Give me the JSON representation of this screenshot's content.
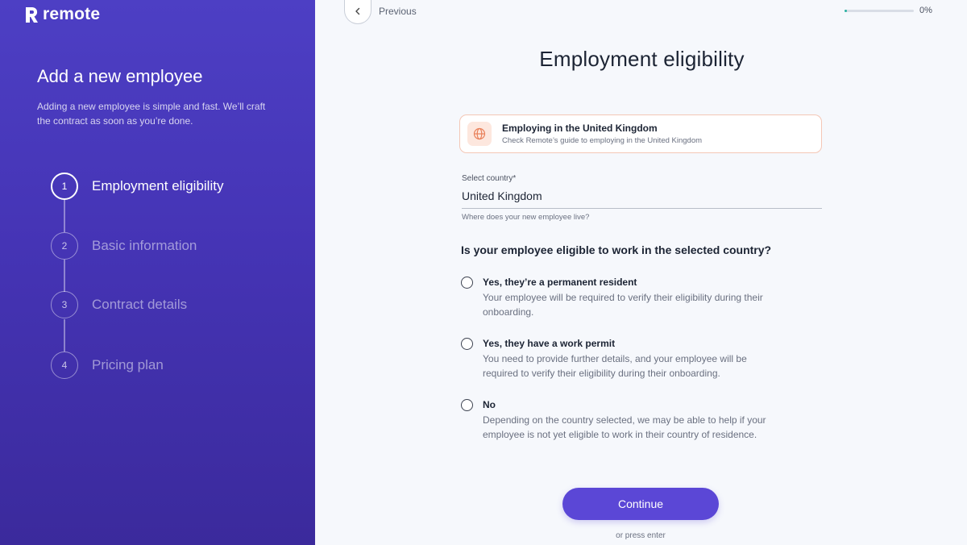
{
  "brand": {
    "name": "remote",
    "logo_icon": "remote-logo-icon"
  },
  "sidebar": {
    "title": "Add a new employee",
    "description": "Adding a new employee is simple and fast. We’ll craft the contract as soon as you’re done.",
    "steps": [
      {
        "number": "1",
        "label": "Employment eligibility",
        "active": true
      },
      {
        "number": "2",
        "label": "Basic information",
        "active": false
      },
      {
        "number": "3",
        "label": "Contract details",
        "active": false
      },
      {
        "number": "4",
        "label": "Pricing plan",
        "active": false
      }
    ]
  },
  "nav": {
    "previous_label": "Previous",
    "previous_icon": "chevron-left-icon"
  },
  "progress": {
    "value": 0,
    "label": "0%"
  },
  "main": {
    "title": "Employment eligibility",
    "guide": {
      "icon": "globe-icon",
      "title": "Employing in the United Kingdom",
      "subtitle": "Check Remote’s guide to employing in the United Kingdom"
    },
    "country_field": {
      "label": "Select country*",
      "value": "United Kingdom",
      "help": "Where does your new employee live?"
    },
    "question": "Is your employee eligible to work in the selected country?",
    "options": [
      {
        "title": "Yes, they’re a permanent resident",
        "description": "Your employee will be required to verify their eligibility during their onboarding."
      },
      {
        "title": "Yes, they have a work permit",
        "description": "You need to provide further details, and your employee will be required to verify their eligibility during their onboarding."
      },
      {
        "title": "No",
        "description": "Depending on the country selected, we may be able to help if your employee is not yet eligible to work in their country of residence."
      }
    ],
    "continue_label": "Continue",
    "hint": "or press enter"
  },
  "colors": {
    "sidebar": "#4534b5",
    "accent": "#5b47d6",
    "progress": "#2bb3a3",
    "guide_border": "#f4c7b6"
  }
}
